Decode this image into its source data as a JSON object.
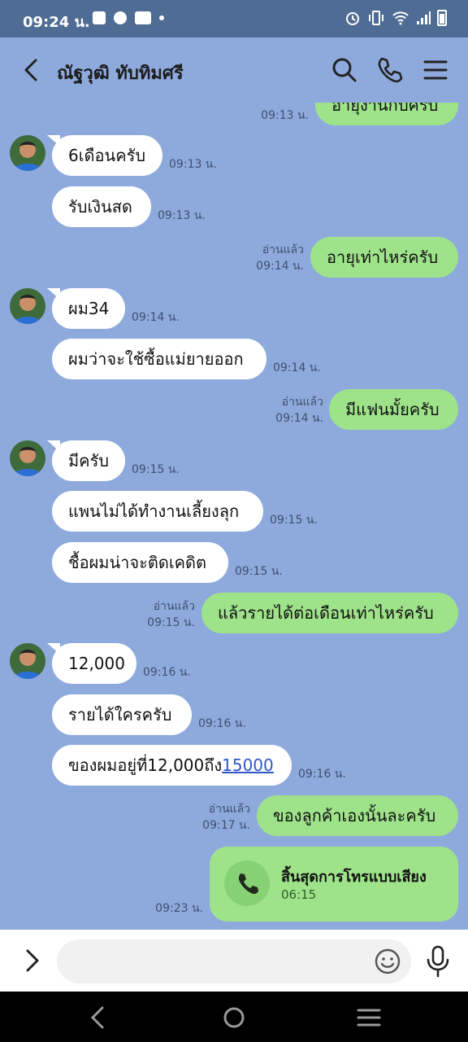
{
  "status_bar": {
    "time": "09:24 น."
  },
  "header": {
    "title": "ณัฐวุฒิ ทับทิมศรี"
  },
  "messages": [
    {
      "dir": "out",
      "text": "อายุงานกี่ปีครับ",
      "time": "09:13 น.",
      "read": ""
    },
    {
      "dir": "in",
      "text": "6เดือนครับ",
      "time": "09:13 น."
    },
    {
      "dir": "in",
      "text": "รับเงินสด",
      "time": "09:13 น."
    },
    {
      "dir": "out",
      "text": "อายุเท่าไหร่ครับ",
      "time": "09:14 น.",
      "read": "อ่านแล้ว"
    },
    {
      "dir": "in",
      "text": "ผม34",
      "time": "09:14 น."
    },
    {
      "dir": "in",
      "text": "ผมว่าจะใช้ซื้อแม่ยายออก",
      "time": "09:14 น."
    },
    {
      "dir": "out",
      "text": "มีแฟนมั้ยครับ",
      "time": "09:14 น.",
      "read": "อ่านแล้ว"
    },
    {
      "dir": "in",
      "text": "มีครับ",
      "time": "09:15 น."
    },
    {
      "dir": "in",
      "text": "แพนไม่ได้ทำงานเลี้ยงลุก",
      "time": "09:15 น."
    },
    {
      "dir": "in",
      "text": "ชื้อผมน่าจะติดเคดิต",
      "time": "09:15 น."
    },
    {
      "dir": "out",
      "text": "แล้วรายได้ต่อเดือนเท่าไหร่ครับ",
      "time": "09:15 น.",
      "read": "อ่านแล้ว"
    },
    {
      "dir": "in",
      "text": "12,000",
      "time": "09:16 น."
    },
    {
      "dir": "in",
      "text": "รายได้ใครครับ",
      "time": "09:16 น."
    },
    {
      "dir": "in",
      "text_prefix": "ของผมอยู่ที่12,000ถึง",
      "text_link": "15000",
      "time": "09:16 น."
    },
    {
      "dir": "out",
      "text": "ของลูกค้าเองนั้นละครับ",
      "time": "09:17 น.",
      "read": "อ่านแล้ว"
    }
  ],
  "call": {
    "title": "สิ้นสุดการโทรแบบเสียง",
    "duration": "06:15",
    "time": "09:23 น."
  },
  "input": {
    "placeholder": ""
  },
  "icons": {
    "back": "chevron-left-icon",
    "search": "search-icon",
    "phone": "phone-icon",
    "menu": "menu-icon",
    "expand": "chevron-right-icon",
    "emoji": "emoji-icon",
    "mic": "mic-icon"
  },
  "colors": {
    "background": "#8eaadd",
    "outgoing": "#9ee38a",
    "incoming": "#ffffff",
    "link": "#2f57c8"
  }
}
